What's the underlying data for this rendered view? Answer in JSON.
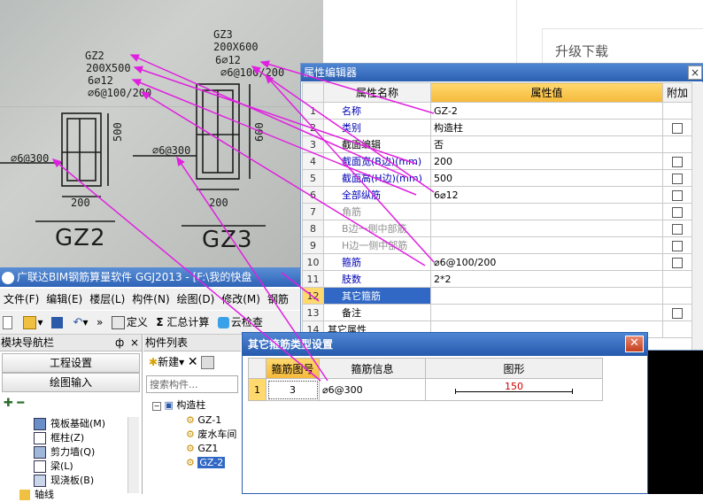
{
  "photo": {
    "gz2_label": "GZ2",
    "gz2_size": "200X500",
    "gz2_main": "6⌀12",
    "gz2_stirrup": "⌀6@100/200",
    "gz3_label": "GZ3",
    "gz3_size": "200X600",
    "gz3_main": "6⌀12",
    "gz3_stirrup": "⌀6@100/200",
    "left_bar": "⌀6@300",
    "mid_bar": "⌀6@300",
    "dim_500": "500",
    "dim_600": "600",
    "dim_200a": "200",
    "dim_200b": "200",
    "big_gz2": "GZ2",
    "big_gz3": "GZ3"
  },
  "web": {
    "upgrade_label": "升级下载"
  },
  "app": {
    "title": "广联达BIM钢筋算量软件 GGJ2013 - [F:\\我的快盘",
    "menu": [
      "文件(F)",
      "编辑(E)",
      "楼层(L)",
      "构件(N)",
      "绘图(D)",
      "修改(M)",
      "钢筋"
    ],
    "toolbar": {
      "define_label": "定义",
      "sum_label": "汇总计算",
      "cloud_label": "云检查",
      "more": "»"
    }
  },
  "nav": {
    "title": "模块导航栏",
    "pin": "ф",
    "close": "×",
    "btn_project": "工程设置",
    "btn_draw": "绘图输入",
    "items": [
      {
        "label": "筏板基础(M)"
      },
      {
        "label": "框柱(Z)"
      },
      {
        "label": "剪力墙(Q)"
      },
      {
        "label": "梁(L)"
      },
      {
        "label": "现浇板(B)"
      },
      {
        "label": "轴线"
      }
    ]
  },
  "comp": {
    "title": "构件列表",
    "new_label": "新建",
    "search_placeholder": "搜索构件...",
    "tree_root": "构造柱",
    "tree_items": [
      "GZ-1",
      "废水车间",
      "GZ1",
      "GZ-2"
    ]
  },
  "prop": {
    "title": "属性编辑器",
    "col_name": "属性名称",
    "col_value": "属性值",
    "col_extra": "附加",
    "rows": [
      {
        "n": "1",
        "name": "名称",
        "value": "GZ-2",
        "check": false,
        "style": "B"
      },
      {
        "n": "2",
        "name": "类别",
        "value": "构造柱",
        "check": true,
        "style": "B"
      },
      {
        "n": "3",
        "name": "截面编辑",
        "value": "否",
        "check": false,
        "style": "K"
      },
      {
        "n": "4",
        "name": "截面宽(B边)(mm)",
        "value": "200",
        "check": true,
        "style": "B"
      },
      {
        "n": "5",
        "name": "截面高(H边)(mm)",
        "value": "500",
        "check": true,
        "style": "B"
      },
      {
        "n": "6",
        "name": "全部纵筋",
        "value": "6⌀12",
        "check": true,
        "style": "B"
      },
      {
        "n": "7",
        "name": "角筋",
        "value": "",
        "check": true,
        "style": "G"
      },
      {
        "n": "8",
        "name": "B边一侧中部筋",
        "value": "",
        "check": true,
        "style": "G"
      },
      {
        "n": "9",
        "name": "H边一侧中部筋",
        "value": "",
        "check": true,
        "style": "G"
      },
      {
        "n": "10",
        "name": "箍筋",
        "value": "⌀6@100/200",
        "check": true,
        "style": "B"
      },
      {
        "n": "11",
        "name": "肢数",
        "value": "2*2",
        "check": false,
        "style": "B"
      },
      {
        "n": "12",
        "name": "其它箍筋",
        "value": "",
        "check": false,
        "style": "S"
      },
      {
        "n": "13",
        "name": "备注",
        "value": "",
        "check": true,
        "style": "K"
      },
      {
        "n": "14",
        "name": "其它属性",
        "value": "",
        "check": false,
        "style": "K"
      }
    ]
  },
  "dialog": {
    "title": "其它箍筋类型设置",
    "close": "✕",
    "col_num": "箍筋图号",
    "col_info": "箍筋信息",
    "col_shape": "图形",
    "row": {
      "n": "1",
      "num": "3",
      "info": "⌀6@300",
      "shape_val": "150"
    }
  },
  "colors": {
    "title_blue": "#2b5fb0",
    "header_gold": "#f5b93a",
    "arrow_magenta": "#e020e0",
    "name_blue": "#0000b4",
    "selected_blue": "#3168c5"
  }
}
